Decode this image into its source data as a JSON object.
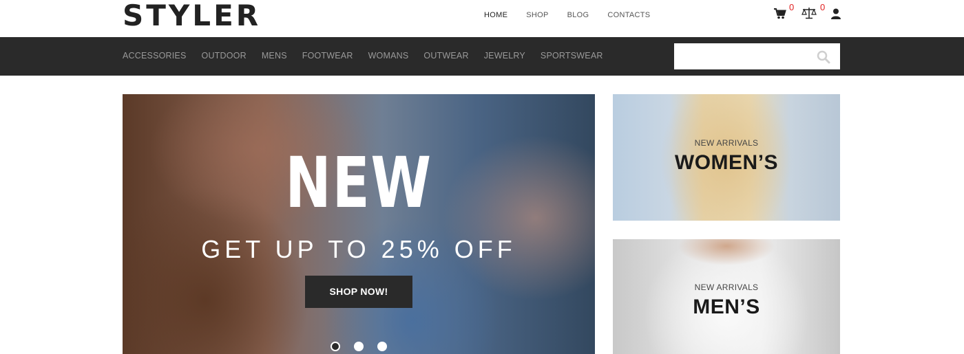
{
  "header": {
    "logo": "STYLER",
    "nav": [
      {
        "label": "HOME",
        "active": true
      },
      {
        "label": "SHOP",
        "active": false
      },
      {
        "label": "BLOG",
        "active": false
      },
      {
        "label": "CONTACTS",
        "active": false
      }
    ],
    "icons": {
      "cart": {
        "icon": "cart-icon",
        "count": "0"
      },
      "compare": {
        "icon": "scales-icon",
        "count": "0"
      },
      "account": {
        "icon": "user-icon"
      }
    },
    "badge_color": "#e02020"
  },
  "categories": [
    "ACCESSORIES",
    "OUTDOOR",
    "MENS",
    "FOOTWEAR",
    "WOMANS",
    "OUTWEAR",
    "JEWELRY",
    "SPORTSWEAR"
  ],
  "search": {
    "placeholder": "",
    "value": "",
    "icon": "search-icon"
  },
  "hero": {
    "title": "NEW",
    "subtitle": "GET UP TO 25% OFF",
    "button": "SHOP NOW!",
    "slides": 3,
    "active_slide": 1
  },
  "banners": [
    {
      "kicker": "NEW ARRIVALS",
      "title": "WOMEN’S"
    },
    {
      "kicker": "NEW ARRIVALS",
      "title": "MEN’S"
    }
  ],
  "colors": {
    "category_bar": "#2a2a2a",
    "accent_dark": "#2a2a2a",
    "badge": "#e02020"
  }
}
